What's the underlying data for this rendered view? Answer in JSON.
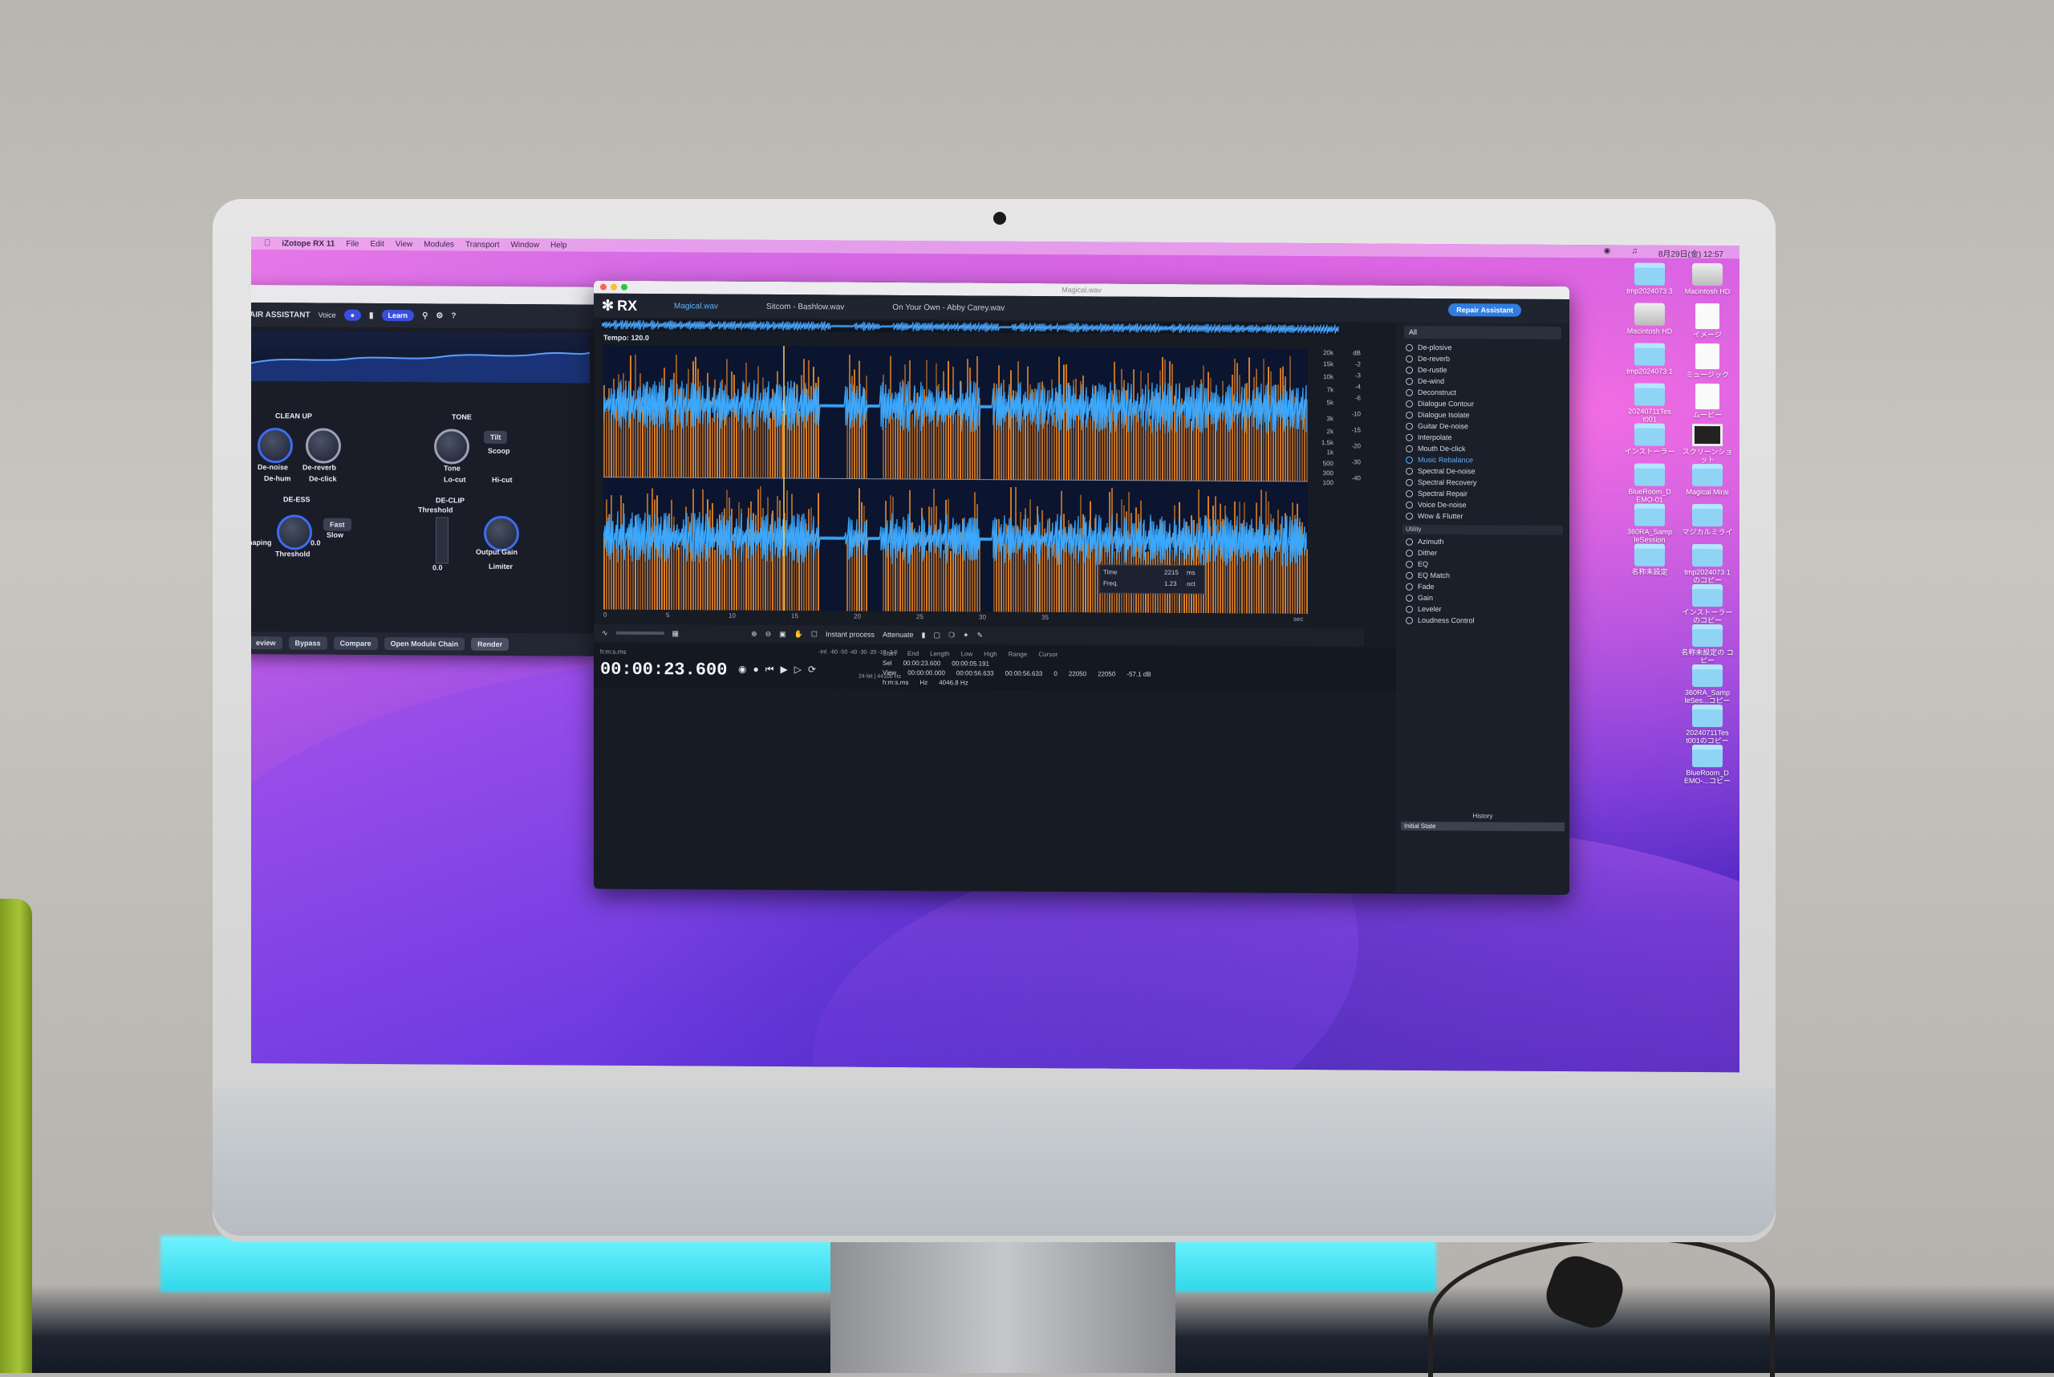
{
  "menubar": {
    "app": "iZotope RX 11",
    "items": [
      "File",
      "Edit",
      "View",
      "Modules",
      "Transport",
      "Window",
      "Help"
    ],
    "clock": "8月29日(金) 12:57"
  },
  "assistant": {
    "title": "AIR ASSISTANT",
    "voice": "Voice",
    "learn": "Learn",
    "cleanup": "CLEAN UP",
    "tone": "TONE",
    "denoise": "De-noise",
    "dereverb": "De-reverb",
    "tone_knob": "Tone",
    "tilt": "Tilt",
    "scoop": "Scoop",
    "dehum": "De-hum",
    "declick": "De-click",
    "locut": "Lo-cut",
    "hicut": "Hi-cut",
    "deess": "DE-ESS",
    "declip": "DE-CLIP",
    "threshold": "Threshold",
    "threshold_top": "Threshold",
    "shaping": "Shaping",
    "fast": "Fast",
    "slow": "Slow",
    "output_gain": "Output Gain",
    "limiter": "Limiter",
    "val_00a": "0.0",
    "val_00b": "0.0",
    "footer": {
      "review": "eview",
      "bypass": "Bypass",
      "compare": "Compare",
      "open_chain": "Open Module Chain",
      "render": "Render"
    }
  },
  "rx": {
    "window_title": "Magical.wav",
    "logo": "RX",
    "tabs": [
      "Magical.wav",
      "Sitcom - Bashlow.wav",
      "On Your Own - Abby Carey.wav"
    ],
    "repair_assistant": "Repair Assistant",
    "tempo": "Tempo: 120.0",
    "freq_scale": [
      "20k",
      "15k",
      "10k",
      "7k",
      "5k",
      "3k",
      "2k",
      "1.5k",
      "1k",
      "500",
      "300",
      "100"
    ],
    "db_scale": [
      "dB",
      "-2",
      "-3",
      "-4",
      "-6",
      "-10",
      "-15",
      "-20",
      "-30",
      "-40"
    ],
    "time_ticks": [
      "0",
      "5",
      "10",
      "15",
      "20",
      "25",
      "30",
      "35",
      "sec"
    ],
    "hint_box": {
      "time_label": "Time",
      "time_val": "2215",
      "time_unit": "ms",
      "freq_label": "Freq.",
      "freq_val": "1.23",
      "freq_unit": "oct"
    },
    "instant_process": "Instant process",
    "attenuate": "Attenuate",
    "timecode": "00:00:23.600",
    "timeformat": "h:m:s.ms",
    "bit_info": "24-bit | 44100 Hz",
    "meter_scale": [
      "-Inf.",
      "-60",
      "-50",
      "-40",
      "-30",
      "-20",
      "-10",
      "-3",
      "0"
    ],
    "selection": {
      "headers": [
        "Start",
        "End",
        "Length",
        "Low",
        "High",
        "Range",
        "Cursor"
      ],
      "sel_label": "Sel",
      "view_label": "View",
      "sel_start": "00:00:23.600",
      "view_start": "00:00:00.000",
      "view_end": "00:00:56.633",
      "view_length": "00:00:56.633",
      "low": "0",
      "high": "22050",
      "range": "22050",
      "cursor_time": "00:00:05.191",
      "cursor_db": "-57.1 dB",
      "cursor_hz": "4046.8 Hz",
      "unit_time": "h:m:s.ms",
      "unit_hz": "Hz"
    },
    "modules_filter": "All",
    "modules": [
      "De-plosive",
      "De-reverb",
      "De-rustle",
      "De-wind",
      "Deconstruct",
      "Dialogue Contour",
      "Dialogue Isolate",
      "Guitar De-noise",
      "Interpolate",
      "Mouth De-click",
      "Music Rebalance",
      "Spectral De-noise",
      "Spectral Recovery",
      "Spectral Repair",
      "Voice De-noise",
      "Wow & Flutter"
    ],
    "active_module": "Music Rebalance",
    "utility_label": "Utility",
    "utility_modules": [
      "Azimuth",
      "Dither",
      "EQ",
      "EQ Match",
      "Fade",
      "Gain",
      "Leveler",
      "Loudness Control"
    ],
    "history_label": "History",
    "history_state": "Initial State"
  },
  "desktop_icons": [
    "tmp2024073 3",
    "Macintosh HD",
    "Macintosh HD",
    "イメージ",
    "tmp2024073 1",
    "ミュージック",
    "20240711Tes t001",
    "ムービー",
    "インストーラー",
    "スクリーンショット",
    "BlueRoom_D EMO-01",
    "Magical Mirai",
    "360RA_Samp leSession",
    "マジカルミライ",
    "名称未設定",
    "tmp2024073 1のコピー",
    "インストーラー のコピー",
    "名称未設定の コピー",
    "360RA_Samp leSes...コピー",
    "20240711Tes t001のコピー",
    "BlueRoom_D EMO-...コピー"
  ],
  "colors": {
    "accent": "#2f7de0",
    "spectrogram_orange": "#f08a24",
    "waveform_blue": "#3aa8ff",
    "wallpaper_magenta": "#e878e7",
    "wallpaper_violet": "#5a2fd6"
  }
}
